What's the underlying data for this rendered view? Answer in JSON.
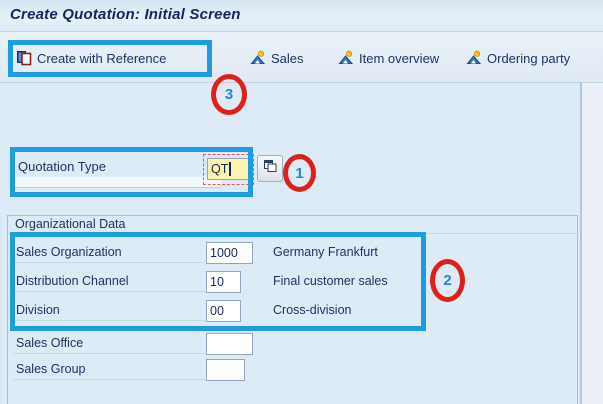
{
  "window": {
    "title": "Create Quotation: Initial Screen"
  },
  "toolbar": {
    "buttons": [
      {
        "label": "Create with Reference",
        "icon": "copy-document-icon"
      },
      {
        "label": "Sales",
        "icon": "person-icon"
      },
      {
        "label": "Item overview",
        "icon": "person-icon"
      },
      {
        "label": "Ordering party",
        "icon": "person-icon"
      }
    ]
  },
  "form": {
    "quotation_type": {
      "label": "Quotation Type",
      "value": "QT"
    }
  },
  "org_section": {
    "title": "Organizational Data",
    "rows": [
      {
        "label": "Sales Organization",
        "value": "1000",
        "description": "Germany Frankfurt"
      },
      {
        "label": "Distribution Channel",
        "value": "10",
        "description": "Final customer sales"
      },
      {
        "label": "Division",
        "value": "00",
        "description": "Cross-division"
      },
      {
        "label": "Sales Office",
        "value": "",
        "description": ""
      },
      {
        "label": "Sales Group",
        "value": "",
        "description": ""
      }
    ]
  },
  "annotations": {
    "markers": [
      {
        "number": "1"
      },
      {
        "number": "2"
      },
      {
        "number": "3"
      }
    ],
    "colors": {
      "highlight_box": "#1f9cdf",
      "circle": "#de201d",
      "number": "#2d7fd4"
    }
  }
}
